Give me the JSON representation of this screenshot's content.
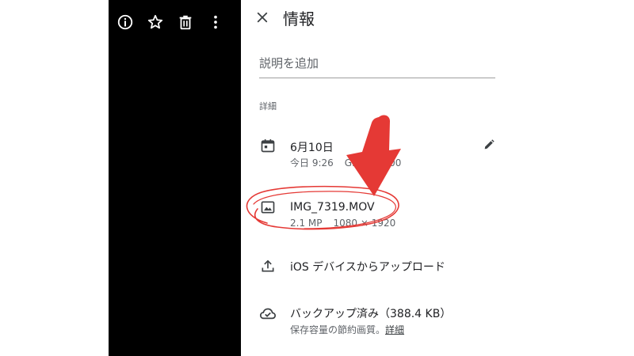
{
  "viewer": {
    "toolbar": {
      "info_icon": "info-circle-icon",
      "star_icon": "star-outline-icon",
      "delete_icon": "trash-icon",
      "more_icon": "more-vertical-icon"
    },
    "background": "#000000"
  },
  "panel": {
    "title": "情報",
    "close_icon": "close-icon",
    "description": {
      "value": "",
      "placeholder": "説明を追加"
    },
    "section_label": "詳細",
    "rows": [
      {
        "icon": "calendar-icon",
        "primary": "6月10日",
        "secondary_parts": [
          "今日 9:26",
          "GMT+09:00"
        ],
        "action_icon": "pencil-icon"
      },
      {
        "icon": "image-icon",
        "primary": "IMG_7319.MOV",
        "secondary_parts": [
          "2.1 MP",
          "1080 × 1920"
        ]
      },
      {
        "icon": "upload-icon",
        "primary": "iOS デバイスからアップロード"
      },
      {
        "icon": "cloud-done-icon",
        "primary": "バックアップ済み（388.4 KB）",
        "secondary_text": "保存容量の節約画質。",
        "secondary_link": "詳細"
      }
    ]
  },
  "annotation": {
    "color": "#e53935"
  }
}
